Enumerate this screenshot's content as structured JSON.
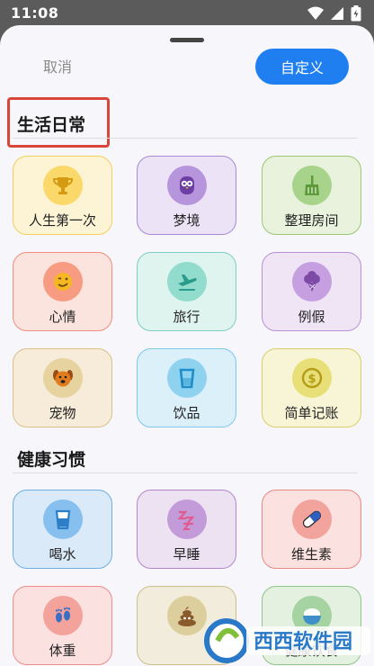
{
  "status": {
    "time": "11:08"
  },
  "header": {
    "cancel": "取消",
    "custom": "自定义"
  },
  "sections": [
    {
      "title": "生活日常",
      "items": [
        {
          "label": "人生第一次",
          "icon": "trophy-icon",
          "bg": "#fdf4d6",
          "border": "#f2cf5b",
          "circle": "#fbd86a",
          "glyph": "#d49b12"
        },
        {
          "label": "梦境",
          "icon": "owl-icon",
          "bg": "#ece4f6",
          "border": "#a98ad6",
          "circle": "#b695dc",
          "glyph": "#6b3fa4"
        },
        {
          "label": "整理房间",
          "icon": "broom-icon",
          "bg": "#e8f2dc",
          "border": "#9cc872",
          "circle": "#a8d38b",
          "glyph": "#5d9b3a"
        },
        {
          "label": "心情",
          "icon": "wink-face-icon",
          "bg": "#fbe4dd",
          "border": "#ef8e7c",
          "circle": "#f79c82",
          "glyph": "#f5b823"
        },
        {
          "label": "旅行",
          "icon": "airplane-icon",
          "bg": "#dff3ef",
          "border": "#7ccfc1",
          "circle": "#92dccd",
          "glyph": "#299b8b"
        },
        {
          "label": "例假",
          "icon": "ice-cream-icon",
          "bg": "#efe5f5",
          "border": "#b990d8",
          "circle": "#c59fe0",
          "glyph": "#7d4aa6"
        },
        {
          "label": "宠物",
          "icon": "dog-icon",
          "bg": "#f6ecd9",
          "border": "#dbbf8a",
          "circle": "#e7d39f",
          "glyph": "#e07c1e"
        },
        {
          "label": "饮品",
          "icon": "cup-icon",
          "bg": "#dcf0fa",
          "border": "#7cc7ea",
          "circle": "#8fd2f0",
          "glyph": "#1f8ec8"
        },
        {
          "label": "简单记账",
          "icon": "coin-icon",
          "bg": "#f8f5d6",
          "border": "#d8cf6a",
          "circle": "#e8df78",
          "glyph": "#b39c14"
        }
      ]
    },
    {
      "title": "健康习惯",
      "items": [
        {
          "label": "喝水",
          "icon": "water-glass-icon",
          "bg": "#dbeaf8",
          "border": "#6eaee4",
          "circle": "#87c0ee",
          "glyph": "#2c7fc7"
        },
        {
          "label": "早睡",
          "icon": "sleep-icon",
          "bg": "#ece2f2",
          "border": "#b386cc",
          "circle": "#c39bd8",
          "glyph": "#e25b8f"
        },
        {
          "label": "维生素",
          "icon": "pill-icon",
          "bg": "#fbe1df",
          "border": "#e78a83",
          "circle": "#f2a39b",
          "glyph": "#2f5fbf"
        },
        {
          "label": "体重",
          "icon": "footprints-icon",
          "bg": "#fbe2e0",
          "border": "#ec8d88",
          "circle": "#f3a29c",
          "glyph": "#3a6fc4"
        },
        {
          "label": "",
          "icon": "poop-icon",
          "bg": "#f1ecdc",
          "border": "#cdbf8c",
          "circle": "#dccf9d",
          "glyph": "#8b5a2b"
        },
        {
          "label": "健康饮食",
          "icon": "rice-bowl-icon",
          "bg": "#e4f1e0",
          "border": "#8fc48a",
          "circle": "#a5d3a1",
          "glyph": "#3f8fc8"
        }
      ]
    }
  ],
  "watermark": {
    "text": "西西软件园"
  }
}
